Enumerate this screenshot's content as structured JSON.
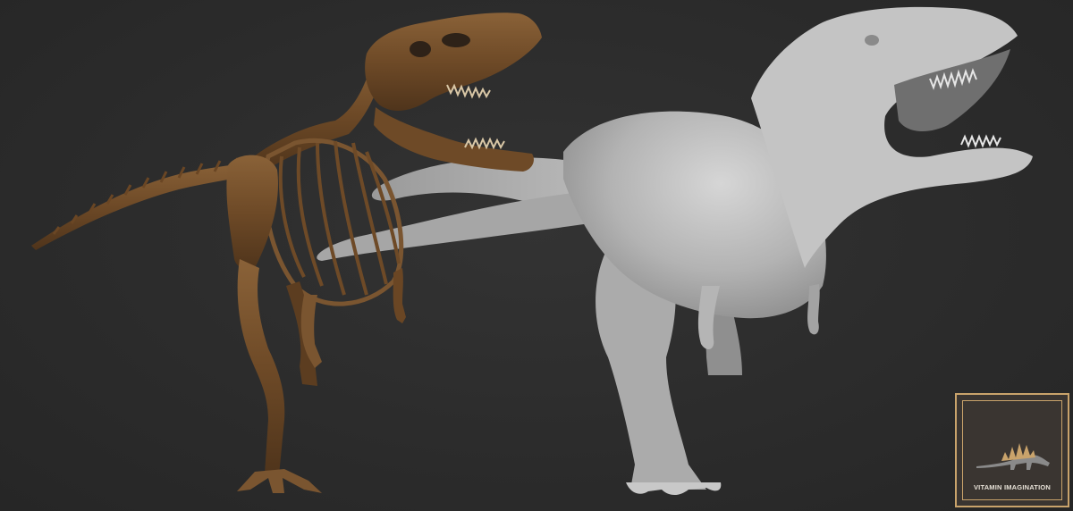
{
  "scene": {
    "background_color": "#2c2c2c",
    "subjects": [
      "tyrannosaurus-skeleton",
      "tyrannosaurus-sculpt"
    ],
    "skeleton_color": "#7a5530",
    "sculpt_color": "#b9b9b9"
  },
  "watermark": {
    "text": "VITAMIN IMAGINATION",
    "frame_color": "#c9a36b",
    "logo_color": "#c9a36b",
    "icon": "stegosaurus-icon"
  }
}
